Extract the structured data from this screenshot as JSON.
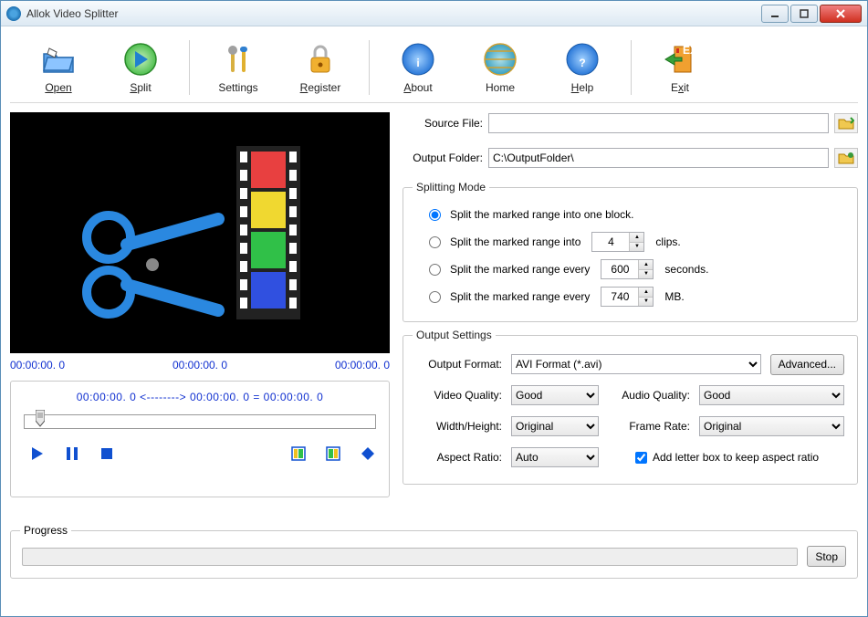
{
  "window": {
    "title": "Allok Video Splitter"
  },
  "toolbar": {
    "open": "Open",
    "split": "Split",
    "settings": "Settings",
    "register": "Register",
    "about": "About",
    "home": "Home",
    "help": "Help",
    "exit": "Exit"
  },
  "preview": {
    "time_left": "00:00:00. 0",
    "time_center": "00:00:00. 0",
    "time_right": "00:00:00. 0",
    "trim_text": "00:00:00. 0  <-------->  00:00:00. 0  =   00:00:00. 0"
  },
  "files": {
    "source_label": "Source File:",
    "source_value": "",
    "output_label": "Output Folder:",
    "output_value": "C:\\OutputFolder\\"
  },
  "split_mode": {
    "legend": "Splitting Mode",
    "opt1": "Split the marked range into one block.",
    "opt2_pre": "Split the marked range into",
    "opt2_val": "4",
    "opt2_post": "clips.",
    "opt3_pre": "Split the marked range every",
    "opt3_val": "600",
    "opt3_post": "seconds.",
    "opt4_pre": "Split the marked range every",
    "opt4_val": "740",
    "opt4_post": "MB."
  },
  "output": {
    "legend": "Output Settings",
    "format_label": "Output Format:",
    "format_value": "AVI Format (*.avi)",
    "advanced": "Advanced...",
    "vq_label": "Video Quality:",
    "vq_value": "Good",
    "aq_label": "Audio Quality:",
    "aq_value": "Good",
    "wh_label": "Width/Height:",
    "wh_value": "Original",
    "fr_label": "Frame Rate:",
    "fr_value": "Original",
    "ar_label": "Aspect Ratio:",
    "ar_value": "Auto",
    "letterbox": "Add letter box to keep aspect ratio"
  },
  "progress": {
    "legend": "Progress",
    "stop": "Stop"
  }
}
